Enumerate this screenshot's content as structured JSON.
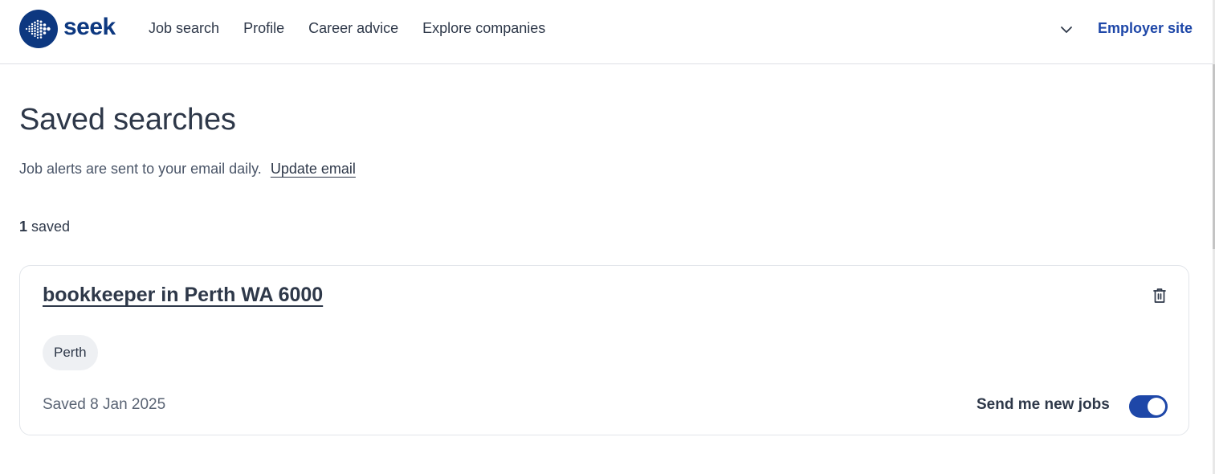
{
  "header": {
    "brand": "seek",
    "nav": [
      "Job search",
      "Profile",
      "Career advice",
      "Explore companies"
    ],
    "employer_link": "Employer site",
    "icons": {
      "menu": "chevron-down-icon"
    }
  },
  "main": {
    "title": "Saved searches",
    "alert_text": "Job alerts are sent to your email daily.",
    "update_email_link": "Update email",
    "count": "1",
    "count_suffix": " saved"
  },
  "saved_searches": [
    {
      "title": "bookkeeper in Perth WA 6000",
      "location_tag": "Perth",
      "saved_date": "Saved 8 Jan 2025",
      "toggle_label": "Send me new jobs",
      "toggle_on": true,
      "icons": {
        "delete": "trash-icon"
      }
    }
  ],
  "colors": {
    "brand_navy": "#0d3880",
    "link_blue": "#1e47a8",
    "text": "#2e3849",
    "muted_text": "#5a6474",
    "border": "#e2e5ea",
    "pill_bg": "#eef0f3"
  }
}
